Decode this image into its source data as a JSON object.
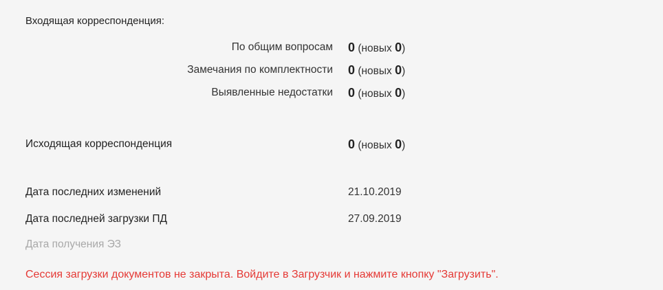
{
  "incoming": {
    "title": "Входящая корреспонденция:",
    "rows": [
      {
        "label": "По общим вопросам",
        "count": "0",
        "new_prefix": "(новых ",
        "new_count": "0",
        "new_suffix": ")"
      },
      {
        "label": "Замечания по комплектности",
        "count": "0",
        "new_prefix": "(новых ",
        "new_count": "0",
        "new_suffix": ")"
      },
      {
        "label": "Выявленные недостатки",
        "count": "0",
        "new_prefix": "(новых ",
        "new_count": "0",
        "new_suffix": ")"
      }
    ]
  },
  "outgoing": {
    "label": "Исходящая корреспонденция",
    "count": "0",
    "new_prefix": "(новых ",
    "new_count": "0",
    "new_suffix": ")"
  },
  "dates": {
    "last_changes_label": "Дата последних изменений",
    "last_changes_value": "21.10.2019",
    "last_pd_upload_label": "Дата последней загрузки ПД",
    "last_pd_upload_value": "27.09.2019",
    "ez_received_label": "Дата получения ЭЗ"
  },
  "warning": "Сессия загрузки документов не закрыта. Войдите в Загрузчик и нажмите кнопку \"Загрузить\".",
  "colors": {
    "background": "#f5f5f5",
    "text": "#333333",
    "muted": "#a8a8a8",
    "warning": "#e53935"
  }
}
